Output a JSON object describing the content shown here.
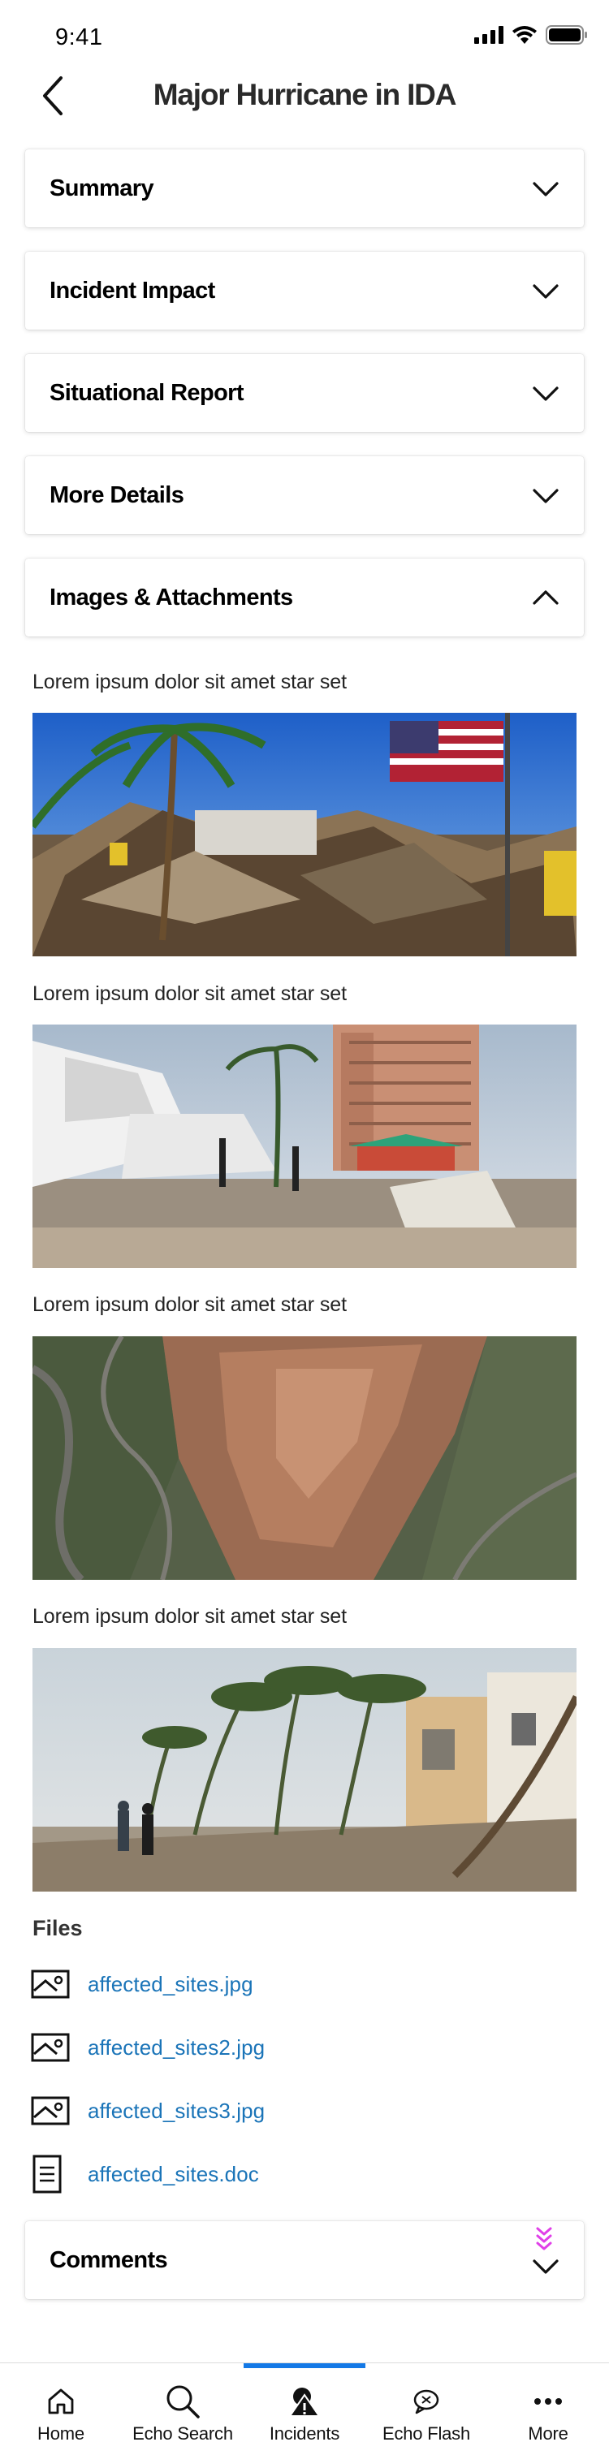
{
  "status_bar": {
    "time": "9:41"
  },
  "header": {
    "title": "Major Hurricane in IDA"
  },
  "sections": {
    "summary": "Summary",
    "incident_impact": "Incident Impact",
    "situational_report": "Situational Report",
    "more_details": "More Details",
    "images_attachments": "Images & Attachments",
    "comments": "Comments"
  },
  "images": [
    {
      "caption": "Lorem ipsum dolor sit amet star set"
    },
    {
      "caption": "Lorem ipsum dolor sit amet star set"
    },
    {
      "caption": "Lorem ipsum dolor sit amet star set"
    },
    {
      "caption": "Lorem ipsum dolor sit amet star set"
    }
  ],
  "files": {
    "heading": "Files",
    "items": [
      {
        "name": "affected_sites.jpg",
        "icon": "image-file-icon"
      },
      {
        "name": "affected_sites2.jpg",
        "icon": "image-file-icon"
      },
      {
        "name": "affected_sites3.jpg",
        "icon": "image-file-icon"
      },
      {
        "name": "affected_sites.doc",
        "icon": "document-file-icon"
      }
    ]
  },
  "tabbar": {
    "active": "Incidents",
    "items": [
      {
        "label": "Home",
        "icon": "home-icon"
      },
      {
        "label": "Echo Search",
        "icon": "search-icon"
      },
      {
        "label": "Incidents",
        "icon": "incident-alert-icon"
      },
      {
        "label": "Echo Flash",
        "icon": "chat-bubble-icon"
      },
      {
        "label": "More",
        "icon": "more-dots-icon"
      }
    ]
  },
  "colors": {
    "link": "#1a74b8",
    "tab_indicator": "#1479e6",
    "scroll_hint": "#e040e8"
  }
}
